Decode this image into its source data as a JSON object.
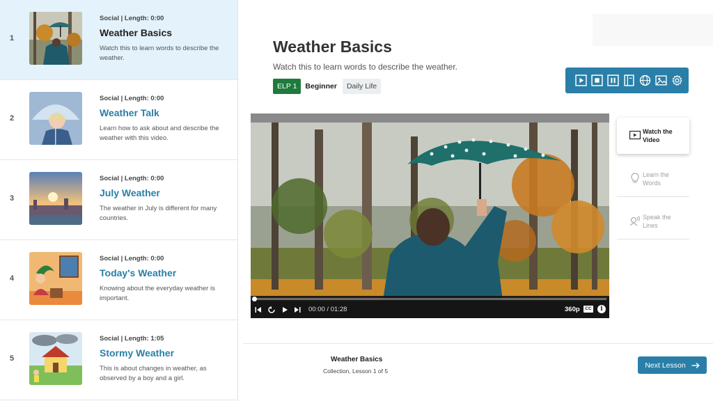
{
  "lessons": [
    {
      "number": "1",
      "meta": "Social | Length: 0:00",
      "title": "Weather Basics",
      "description": "Watch this to learn words to describe the weather.",
      "active": true
    },
    {
      "number": "2",
      "meta": "Social | Length: 0:00",
      "title": "Weather Talk",
      "description": "Learn how to ask about and describe the weather with this video."
    },
    {
      "number": "3",
      "meta": "Social | Length: 0:00",
      "title": "July Weather",
      "description": "The weather in July is different for many countries."
    },
    {
      "number": "4",
      "meta": "Social | Length: 0:00",
      "title": "Today's Weather",
      "description": "Knowing about the everyday weather is important."
    },
    {
      "number": "5",
      "meta": "Social | Length: 1:05",
      "title": "Stormy Weather",
      "description": "This is about changes in weather, as observed by a boy and a girl."
    }
  ],
  "main": {
    "title": "Weather Basics",
    "subtitle": "Watch this to learn words to describe the weather.",
    "tags": {
      "level": "ELP 1",
      "level_name": "Beginner",
      "topic": "Daily Life"
    }
  },
  "toolbar": {
    "icons": [
      "play-icon",
      "stop-icon",
      "pause-icon",
      "book-icon",
      "globe-icon",
      "image-icon",
      "gear-icon"
    ]
  },
  "video": {
    "time": "00:00 / 01:28",
    "quality": "360p",
    "cc_label": "CC",
    "info_label": "i",
    "progress": 0.0
  },
  "steps": [
    {
      "label": "Watch the Video",
      "icon": "video-icon",
      "active": true
    },
    {
      "label": "Learn the Words",
      "icon": "lightbulb-icon",
      "active": false
    },
    {
      "label": "Speak the Lines",
      "icon": "speak-icon",
      "active": false
    }
  ],
  "footer": {
    "title": "Weather Basics",
    "subtitle": "Collection, Lesson 1 of 5",
    "next_label": "Next Lesson"
  },
  "colors": {
    "accent": "#2a7fa8",
    "level_green": "#1f7a3d",
    "active_row": "#e3f2fb"
  }
}
